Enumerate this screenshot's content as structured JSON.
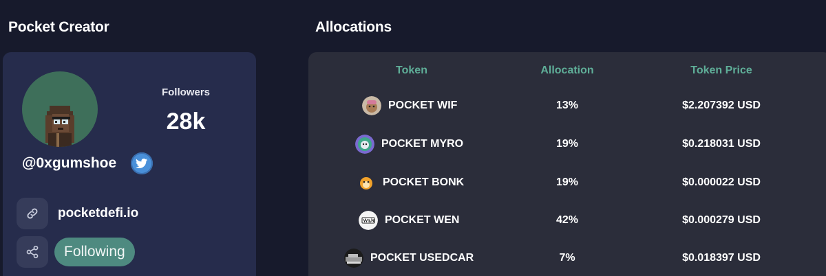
{
  "creator": {
    "section_title": "Pocket Creator",
    "followers_label": "Followers",
    "followers_count": "28k",
    "handle": "@0xgumshoe",
    "website": "pocketdefi.io",
    "following_label": "Following"
  },
  "allocations": {
    "section_title": "Allocations",
    "headers": {
      "token": "Token",
      "allocation": "Allocation",
      "price": "Token Price"
    },
    "rows": [
      {
        "token": "POCKET WIF",
        "allocation": "13%",
        "price": "$2.207392 USD",
        "icon": "wif-dog-icon"
      },
      {
        "token": "POCKET MYRO",
        "allocation": "19%",
        "price": "$0.218031 USD",
        "icon": "myro-icon"
      },
      {
        "token": "POCKET BONK",
        "allocation": "19%",
        "price": "$0.000022 USD",
        "icon": "bonk-icon"
      },
      {
        "token": "POCKET WEN",
        "allocation": "42%",
        "price": "$0.000279 USD",
        "icon": "wen-icon"
      },
      {
        "token": "POCKET USEDCAR",
        "allocation": "7%",
        "price": "$0.018397 USD",
        "icon": "usedcar-icon"
      }
    ]
  },
  "colors": {
    "background": "#171a2c",
    "creator_card": "#262c4c",
    "allocations_card": "#2b2d3a",
    "accent_header": "#5fae98",
    "following_button": "#4e8a80",
    "twitter_blue": "#4a90d9"
  }
}
